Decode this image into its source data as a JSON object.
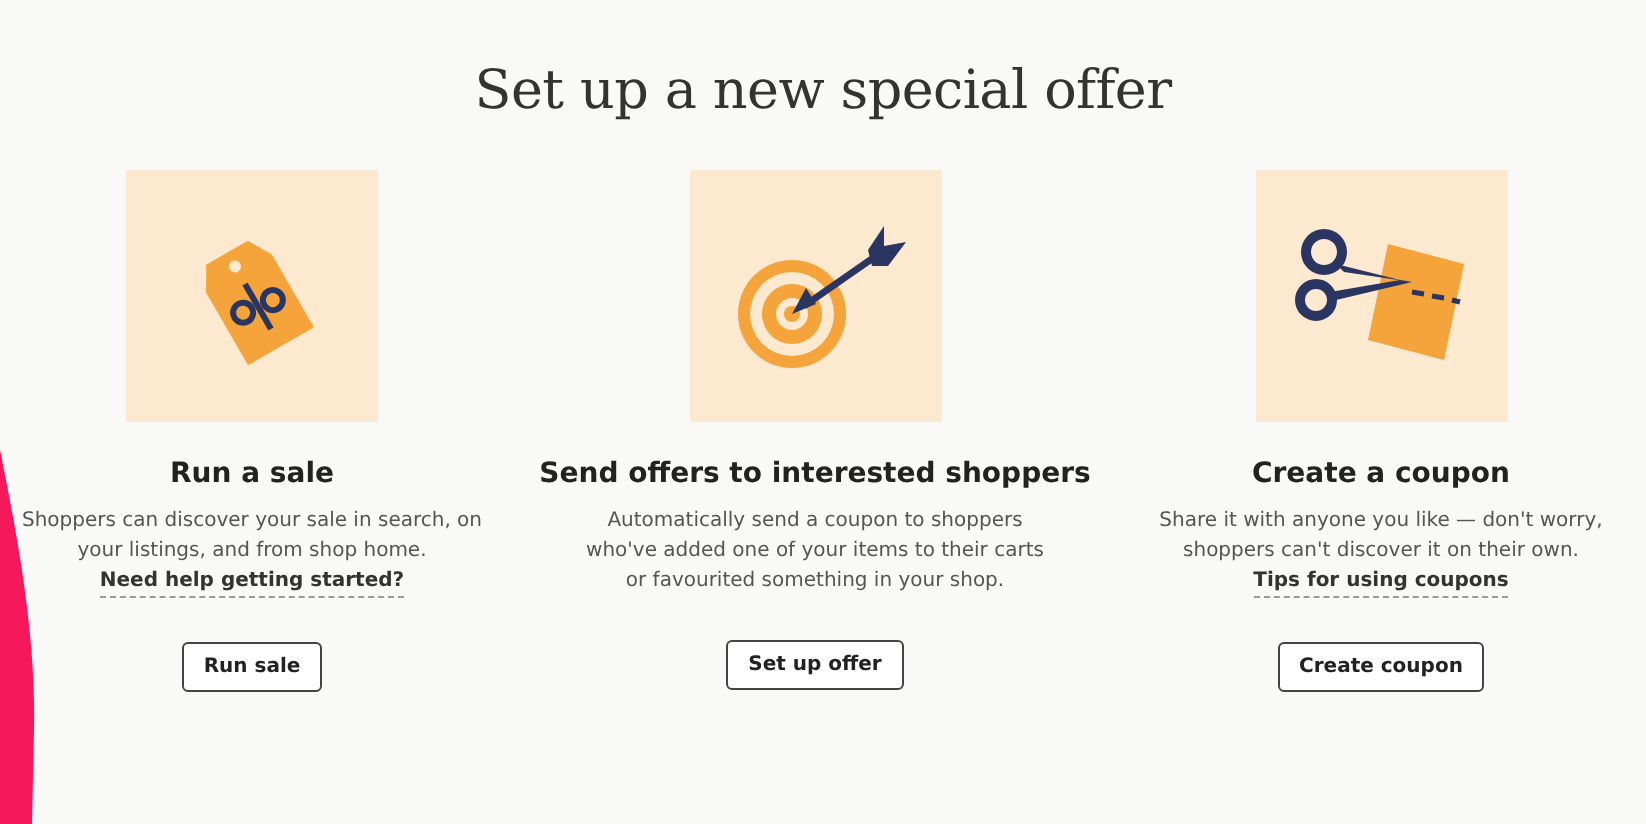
{
  "title": "Set up a new special offer",
  "offers": [
    {
      "kind": "tag",
      "heading": "Run a sale",
      "description": "Shoppers can discover your sale in search, on your listings, and from shop home.",
      "link": "Need help getting started?",
      "button": "Run sale"
    },
    {
      "kind": "target",
      "heading": "Send offers to interested shoppers",
      "description": "Automatically send a coupon to shoppers who've added one of your items to their carts or favourited something in your shop.",
      "button": "Set up offer"
    },
    {
      "kind": "scissors",
      "heading": "Create a coupon",
      "description": "Share it with anyone you like — don't worry, shoppers can't discover it on their own.",
      "link": "Tips for using coupons",
      "button": "Create coupon"
    }
  ]
}
